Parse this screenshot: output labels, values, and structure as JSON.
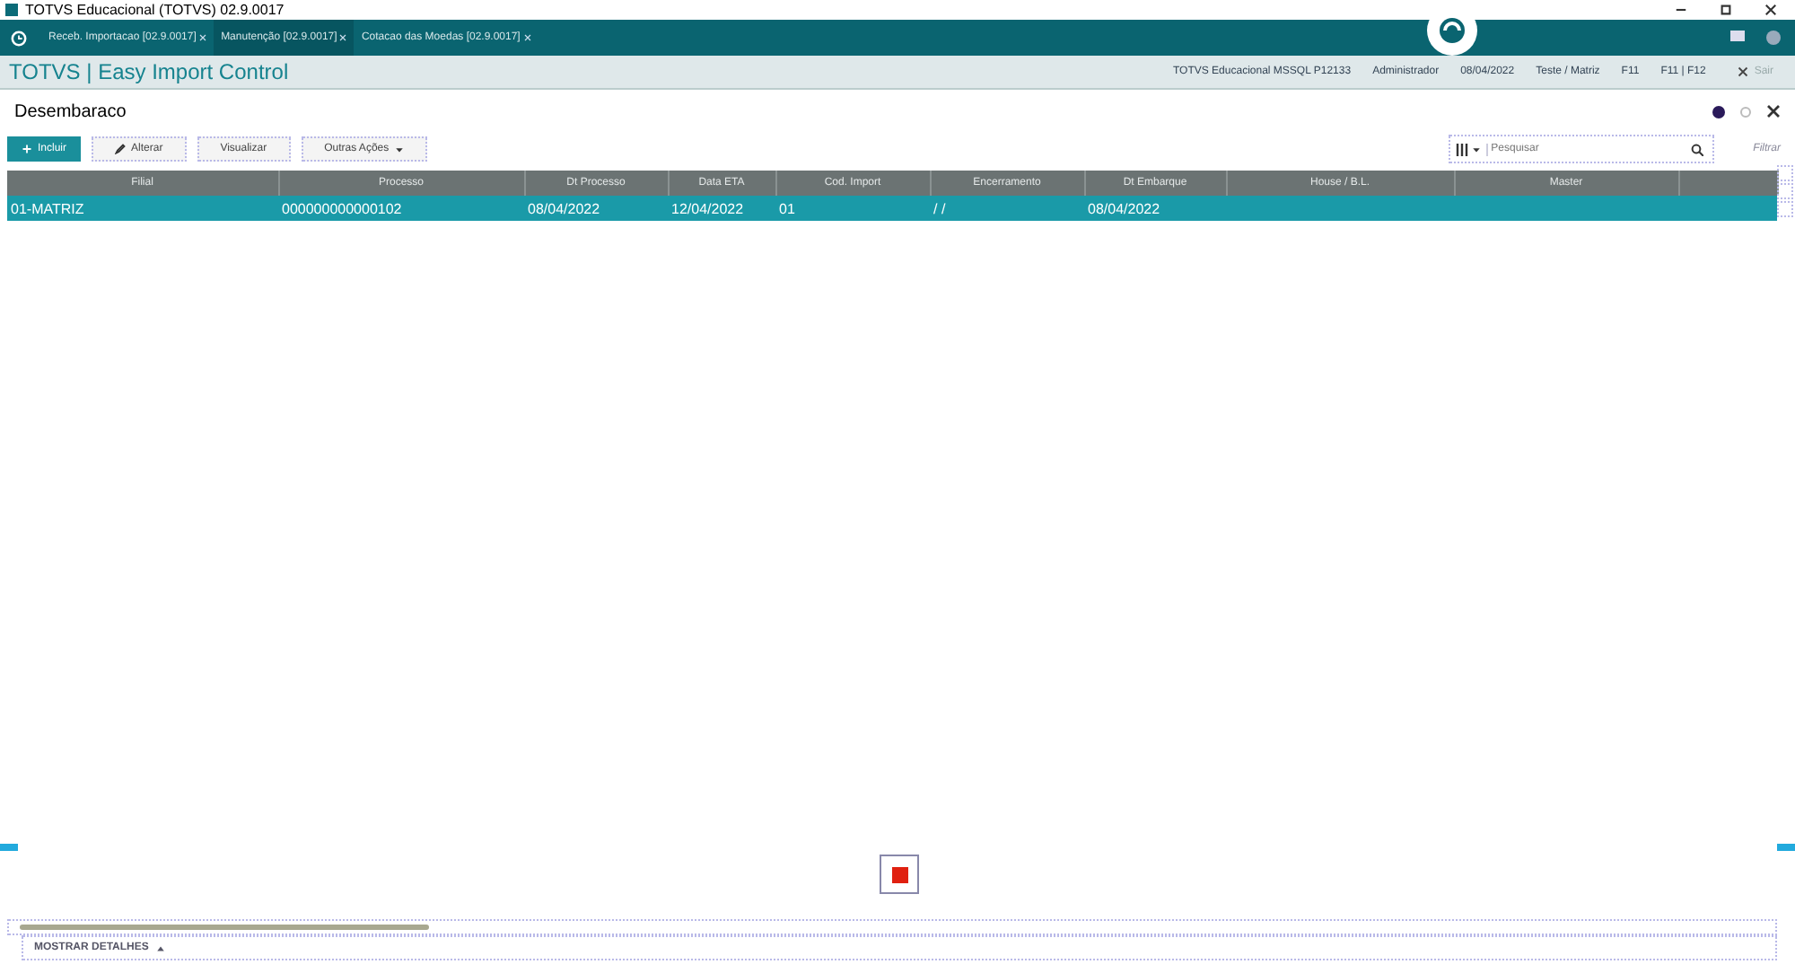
{
  "window": {
    "title": "TOTVS Educacional (TOTVS) 02.9.0017"
  },
  "tabs": [
    {
      "label": "Receb. Importacao [02.9.0017]",
      "selected": false
    },
    {
      "label": "Manutenção [02.9.0017]",
      "selected": true
    },
    {
      "label": "Cotacao das Moedas [02.9.0017]",
      "selected": false
    }
  ],
  "header": {
    "app_title": "TOTVS | Easy Import Control",
    "info": [
      "TOTVS Educacional MSSQL P12133",
      "Administrador",
      "08/04/2022",
      "Teste / Matriz",
      "F11",
      "F11 | F12"
    ],
    "exit": "Sair"
  },
  "page": {
    "title": "Desembaraco"
  },
  "toolbar": {
    "buttons": [
      {
        "label": "Incluir",
        "kind": "primary"
      },
      {
        "label": "Alterar",
        "kind": "edit"
      },
      {
        "label": "Visualizar",
        "kind": "plain"
      },
      {
        "label": "Outras Ações",
        "kind": "menu"
      }
    ],
    "search": {
      "placeholder": "Pesquisar"
    },
    "filter": "Filtrar"
  },
  "table": {
    "columns": [
      "Filial",
      "Processo",
      "Dt Processo",
      "Data ETA",
      "Cod. Import",
      "Encerramento",
      "Dt Embarque",
      "House / B.L.",
      "Master"
    ],
    "rows": [
      {
        "selected": true,
        "cells": [
          "01-MATRIZ",
          "000000000000102",
          "08/04/2022",
          "12/04/2022",
          "01",
          "/  /",
          "08/04/2022",
          "",
          ""
        ]
      }
    ]
  },
  "footer": {
    "details": "MOSTRAR DETALHES"
  }
}
